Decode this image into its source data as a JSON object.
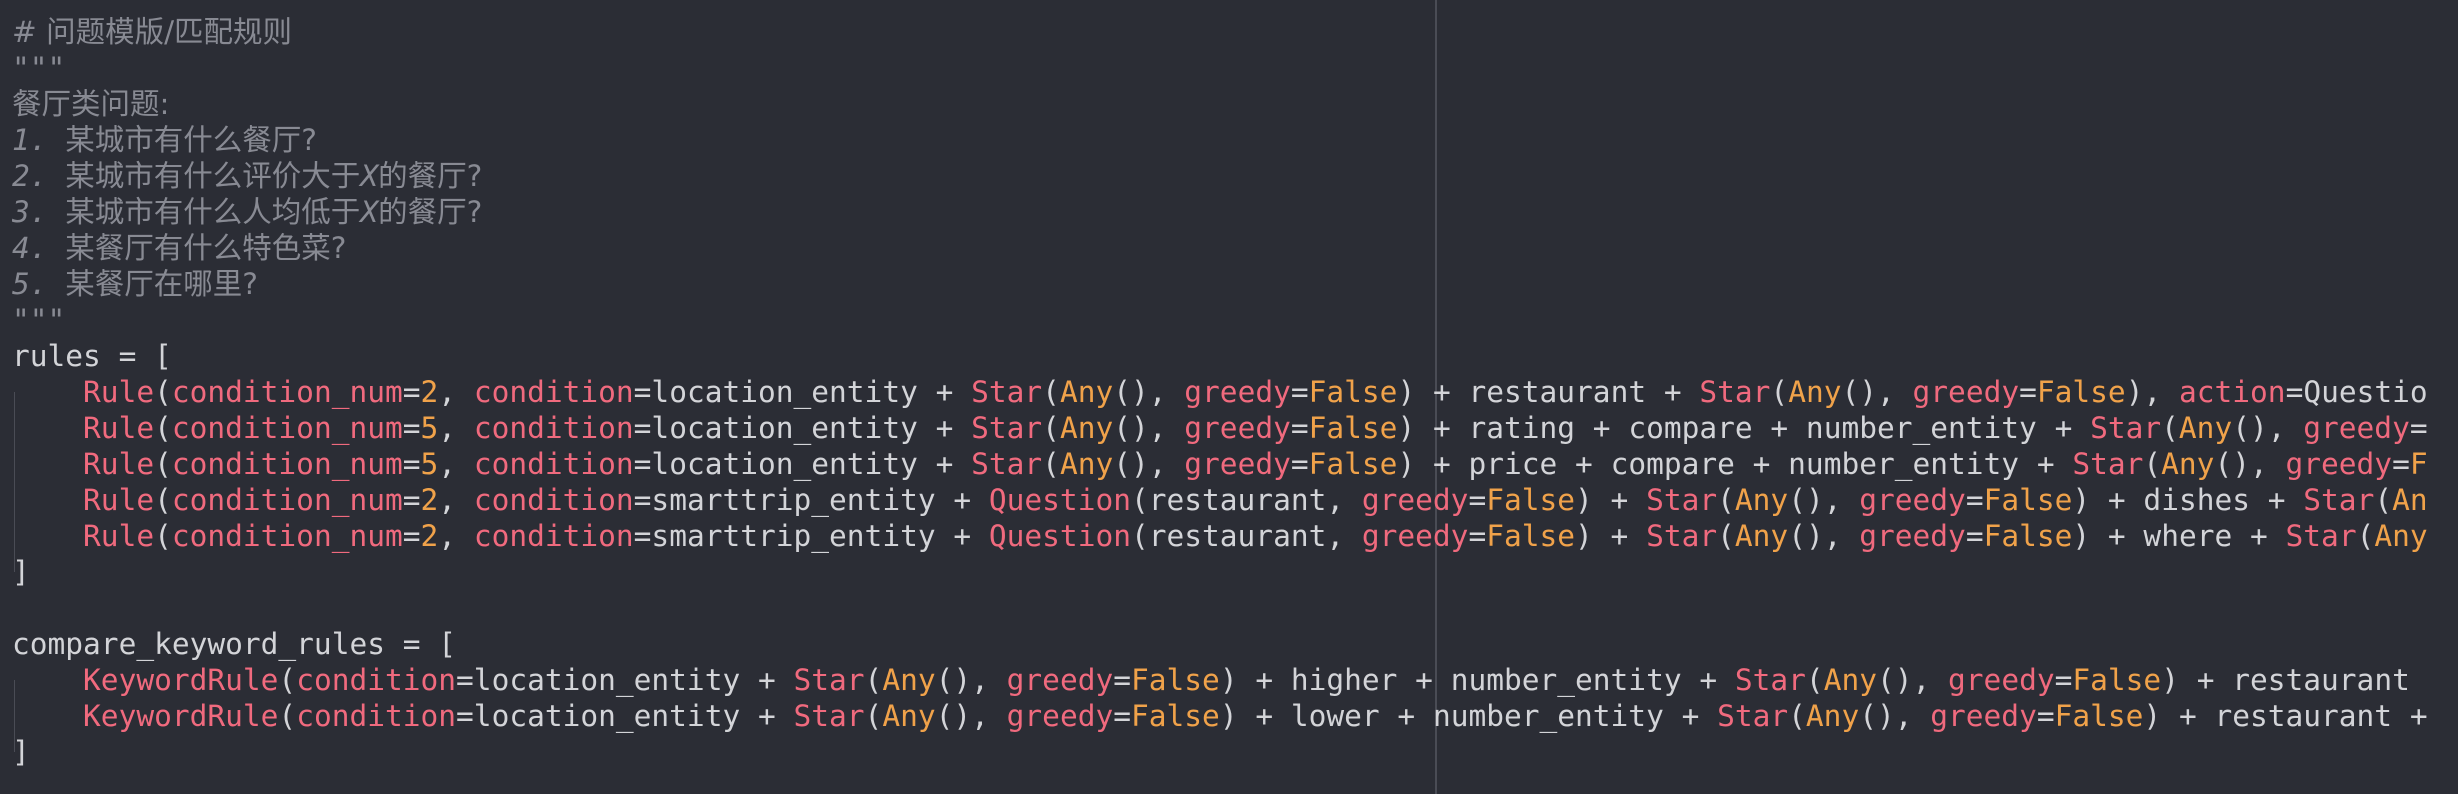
{
  "editor": {
    "lines": [
      [
        {
          "t": "# 问题模版/匹配规则",
          "c": "comment-cjk"
        }
      ],
      [
        {
          "t": "\"\"\"",
          "c": "comment"
        }
      ],
      [
        {
          "t": "餐厅类问题:",
          "c": "comment-cjk"
        }
      ],
      [
        {
          "t": "1. ",
          "c": "comment-italic"
        },
        {
          "t": "某城市有什么餐厅?",
          "c": "comment-cjk"
        }
      ],
      [
        {
          "t": "2. ",
          "c": "comment-italic"
        },
        {
          "t": "某城市有什么评价大于",
          "c": "comment-cjk"
        },
        {
          "t": "X",
          "c": "comment-italic"
        },
        {
          "t": "的餐厅?",
          "c": "comment-cjk"
        }
      ],
      [
        {
          "t": "3. ",
          "c": "comment-italic"
        },
        {
          "t": "某城市有什么人均低于",
          "c": "comment-cjk"
        },
        {
          "t": "X",
          "c": "comment-italic"
        },
        {
          "t": "的餐厅?",
          "c": "comment-cjk"
        }
      ],
      [
        {
          "t": "4. ",
          "c": "comment-italic"
        },
        {
          "t": "某餐厅有什么特色菜?",
          "c": "comment-cjk"
        }
      ],
      [
        {
          "t": "5. ",
          "c": "comment-italic"
        },
        {
          "t": "某餐厅在哪里?",
          "c": "comment-cjk"
        }
      ],
      [
        {
          "t": "\"\"\"",
          "c": "comment"
        }
      ],
      [
        {
          "t": "rules = [",
          "c": "plain"
        }
      ],
      [
        {
          "t": "    ",
          "c": "plain"
        },
        {
          "t": "Rule",
          "c": "fn"
        },
        {
          "t": "(",
          "c": "plain"
        },
        {
          "t": "condition_num",
          "c": "kw"
        },
        {
          "t": "=",
          "c": "plain"
        },
        {
          "t": "2",
          "c": "num"
        },
        {
          "t": ", ",
          "c": "plain"
        },
        {
          "t": "condition",
          "c": "kw"
        },
        {
          "t": "=location_entity + ",
          "c": "plain"
        },
        {
          "t": "Star",
          "c": "fn"
        },
        {
          "t": "(",
          "c": "plain"
        },
        {
          "t": "Any",
          "c": "num"
        },
        {
          "t": "(), ",
          "c": "plain"
        },
        {
          "t": "greedy",
          "c": "kw"
        },
        {
          "t": "=",
          "c": "plain"
        },
        {
          "t": "False",
          "c": "num"
        },
        {
          "t": ") + restaurant + ",
          "c": "plain"
        },
        {
          "t": "Star",
          "c": "fn"
        },
        {
          "t": "(",
          "c": "plain"
        },
        {
          "t": "Any",
          "c": "num"
        },
        {
          "t": "(), ",
          "c": "plain"
        },
        {
          "t": "greedy",
          "c": "kw"
        },
        {
          "t": "=",
          "c": "plain"
        },
        {
          "t": "False",
          "c": "num"
        },
        {
          "t": "), ",
          "c": "plain"
        },
        {
          "t": "action",
          "c": "kw"
        },
        {
          "t": "=Questio",
          "c": "plain"
        }
      ],
      [
        {
          "t": "    ",
          "c": "plain"
        },
        {
          "t": "Rule",
          "c": "fn"
        },
        {
          "t": "(",
          "c": "plain"
        },
        {
          "t": "condition_num",
          "c": "kw"
        },
        {
          "t": "=",
          "c": "plain"
        },
        {
          "t": "5",
          "c": "num"
        },
        {
          "t": ", ",
          "c": "plain"
        },
        {
          "t": "condition",
          "c": "kw"
        },
        {
          "t": "=location_entity + ",
          "c": "plain"
        },
        {
          "t": "Star",
          "c": "fn"
        },
        {
          "t": "(",
          "c": "plain"
        },
        {
          "t": "Any",
          "c": "num"
        },
        {
          "t": "(), ",
          "c": "plain"
        },
        {
          "t": "greedy",
          "c": "kw"
        },
        {
          "t": "=",
          "c": "plain"
        },
        {
          "t": "False",
          "c": "num"
        },
        {
          "t": ") + rating + compare + number_entity + ",
          "c": "plain"
        },
        {
          "t": "Star",
          "c": "fn"
        },
        {
          "t": "(",
          "c": "plain"
        },
        {
          "t": "Any",
          "c": "num"
        },
        {
          "t": "(), ",
          "c": "plain"
        },
        {
          "t": "greedy",
          "c": "kw"
        },
        {
          "t": "=",
          "c": "plain"
        }
      ],
      [
        {
          "t": "    ",
          "c": "plain"
        },
        {
          "t": "Rule",
          "c": "fn"
        },
        {
          "t": "(",
          "c": "plain"
        },
        {
          "t": "condition_num",
          "c": "kw"
        },
        {
          "t": "=",
          "c": "plain"
        },
        {
          "t": "5",
          "c": "num"
        },
        {
          "t": ", ",
          "c": "plain"
        },
        {
          "t": "condition",
          "c": "kw"
        },
        {
          "t": "=location_entity + ",
          "c": "plain"
        },
        {
          "t": "Star",
          "c": "fn"
        },
        {
          "t": "(",
          "c": "plain"
        },
        {
          "t": "Any",
          "c": "num"
        },
        {
          "t": "(), ",
          "c": "plain"
        },
        {
          "t": "greedy",
          "c": "kw"
        },
        {
          "t": "=",
          "c": "plain"
        },
        {
          "t": "False",
          "c": "num"
        },
        {
          "t": ") + price + compare + number_entity + ",
          "c": "plain"
        },
        {
          "t": "Star",
          "c": "fn"
        },
        {
          "t": "(",
          "c": "plain"
        },
        {
          "t": "Any",
          "c": "num"
        },
        {
          "t": "(), ",
          "c": "plain"
        },
        {
          "t": "greedy",
          "c": "kw"
        },
        {
          "t": "=",
          "c": "plain"
        },
        {
          "t": "F",
          "c": "num"
        }
      ],
      [
        {
          "t": "    ",
          "c": "plain"
        },
        {
          "t": "Rule",
          "c": "fn"
        },
        {
          "t": "(",
          "c": "plain"
        },
        {
          "t": "condition_num",
          "c": "kw"
        },
        {
          "t": "=",
          "c": "plain"
        },
        {
          "t": "2",
          "c": "num"
        },
        {
          "t": ", ",
          "c": "plain"
        },
        {
          "t": "condition",
          "c": "kw"
        },
        {
          "t": "=smarttrip_entity + ",
          "c": "plain"
        },
        {
          "t": "Question",
          "c": "fn"
        },
        {
          "t": "(restaurant, ",
          "c": "plain"
        },
        {
          "t": "greedy",
          "c": "kw"
        },
        {
          "t": "=",
          "c": "plain"
        },
        {
          "t": "False",
          "c": "num"
        },
        {
          "t": ") + ",
          "c": "plain"
        },
        {
          "t": "Star",
          "c": "fn"
        },
        {
          "t": "(",
          "c": "plain"
        },
        {
          "t": "Any",
          "c": "num"
        },
        {
          "t": "(), ",
          "c": "plain"
        },
        {
          "t": "greedy",
          "c": "kw"
        },
        {
          "t": "=",
          "c": "plain"
        },
        {
          "t": "False",
          "c": "num"
        },
        {
          "t": ") + dishes + ",
          "c": "plain"
        },
        {
          "t": "Star",
          "c": "fn"
        },
        {
          "t": "(",
          "c": "plain"
        },
        {
          "t": "An",
          "c": "num"
        }
      ],
      [
        {
          "t": "    ",
          "c": "plain"
        },
        {
          "t": "Rule",
          "c": "fn"
        },
        {
          "t": "(",
          "c": "plain"
        },
        {
          "t": "condition_num",
          "c": "kw"
        },
        {
          "t": "=",
          "c": "plain"
        },
        {
          "t": "2",
          "c": "num"
        },
        {
          "t": ", ",
          "c": "plain"
        },
        {
          "t": "condition",
          "c": "kw"
        },
        {
          "t": "=smarttrip_entity + ",
          "c": "plain"
        },
        {
          "t": "Question",
          "c": "fn"
        },
        {
          "t": "(restaurant, ",
          "c": "plain"
        },
        {
          "t": "greedy",
          "c": "kw"
        },
        {
          "t": "=",
          "c": "plain"
        },
        {
          "t": "False",
          "c": "num"
        },
        {
          "t": ") + ",
          "c": "plain"
        },
        {
          "t": "Star",
          "c": "fn"
        },
        {
          "t": "(",
          "c": "plain"
        },
        {
          "t": "Any",
          "c": "num"
        },
        {
          "t": "(), ",
          "c": "plain"
        },
        {
          "t": "greedy",
          "c": "kw"
        },
        {
          "t": "=",
          "c": "plain"
        },
        {
          "t": "False",
          "c": "num"
        },
        {
          "t": ") + where + ",
          "c": "plain"
        },
        {
          "t": "Star",
          "c": "fn"
        },
        {
          "t": "(",
          "c": "plain"
        },
        {
          "t": "Any",
          "c": "num"
        }
      ],
      [
        {
          "t": "]",
          "c": "plain"
        }
      ],
      [
        {
          "t": "",
          "c": "plain"
        }
      ],
      [
        {
          "t": "compare_keyword_rules = [",
          "c": "plain"
        }
      ],
      [
        {
          "t": "    ",
          "c": "plain"
        },
        {
          "t": "KeywordRule",
          "c": "fn"
        },
        {
          "t": "(",
          "c": "plain"
        },
        {
          "t": "condition",
          "c": "kw"
        },
        {
          "t": "=location_entity + ",
          "c": "plain"
        },
        {
          "t": "Star",
          "c": "fn"
        },
        {
          "t": "(",
          "c": "plain"
        },
        {
          "t": "Any",
          "c": "num"
        },
        {
          "t": "(), ",
          "c": "plain"
        },
        {
          "t": "greedy",
          "c": "kw"
        },
        {
          "t": "=",
          "c": "plain"
        },
        {
          "t": "False",
          "c": "num"
        },
        {
          "t": ") + higher + number_entity + ",
          "c": "plain"
        },
        {
          "t": "Star",
          "c": "fn"
        },
        {
          "t": "(",
          "c": "plain"
        },
        {
          "t": "Any",
          "c": "num"
        },
        {
          "t": "(), ",
          "c": "plain"
        },
        {
          "t": "greedy",
          "c": "kw"
        },
        {
          "t": "=",
          "c": "plain"
        },
        {
          "t": "False",
          "c": "num"
        },
        {
          "t": ") + restaurant ",
          "c": "plain"
        }
      ],
      [
        {
          "t": "    ",
          "c": "plain"
        },
        {
          "t": "KeywordRule",
          "c": "fn"
        },
        {
          "t": "(",
          "c": "plain"
        },
        {
          "t": "condition",
          "c": "kw"
        },
        {
          "t": "=location_entity + ",
          "c": "plain"
        },
        {
          "t": "Star",
          "c": "fn"
        },
        {
          "t": "(",
          "c": "plain"
        },
        {
          "t": "Any",
          "c": "num"
        },
        {
          "t": "(), ",
          "c": "plain"
        },
        {
          "t": "greedy",
          "c": "kw"
        },
        {
          "t": "=",
          "c": "plain"
        },
        {
          "t": "False",
          "c": "num"
        },
        {
          "t": ") + lower + number_entity + ",
          "c": "plain"
        },
        {
          "t": "Star",
          "c": "fn"
        },
        {
          "t": "(",
          "c": "plain"
        },
        {
          "t": "Any",
          "c": "num"
        },
        {
          "t": "(), ",
          "c": "plain"
        },
        {
          "t": "greedy",
          "c": "kw"
        },
        {
          "t": "=",
          "c": "plain"
        },
        {
          "t": "False",
          "c": "num"
        },
        {
          "t": ") + restaurant +",
          "c": "plain"
        }
      ],
      [
        {
          "t": "]",
          "c": "plain"
        }
      ]
    ]
  },
  "theme": {
    "background": "#2b2d35",
    "comment": "#888a93",
    "function": "#f06a7e",
    "keyword_arg": "#f06a7e",
    "number_constant": "#f0a24a",
    "text": "#d3d4d8"
  }
}
